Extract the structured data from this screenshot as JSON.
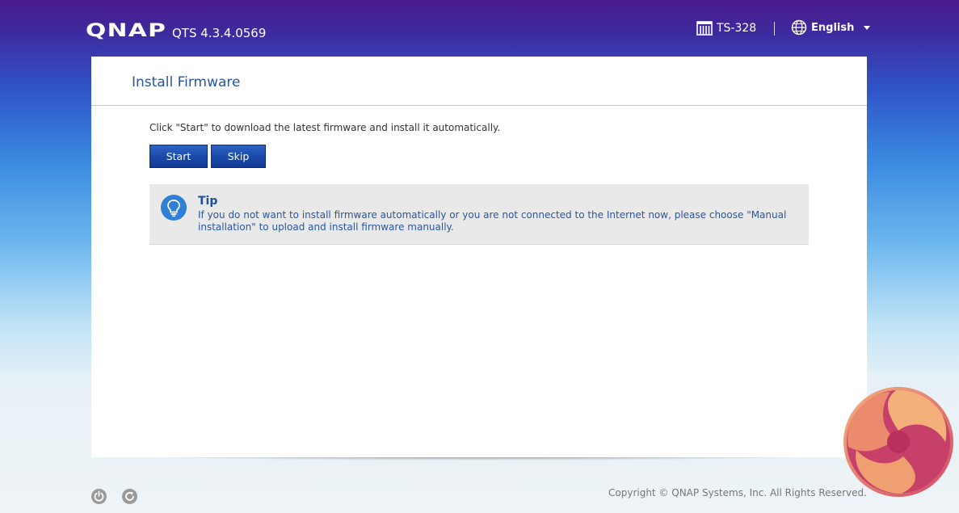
{
  "header": {
    "logo": "QNAP",
    "version": "QTS 4.3.4.0569",
    "model": "TS-328",
    "language": "English"
  },
  "panel": {
    "title": "Install Firmware",
    "description": "Click \"Start\" to download the latest firmware and install it automatically.",
    "buttons": {
      "start": "Start",
      "skip": "Skip"
    },
    "tip": {
      "title": "Tip",
      "text_before": "If you do not want to install firmware automatically or you are not connected to the Internet now, please choose ",
      "link": "\"Manual installation\"",
      "text_after": " to upload and install firmware manually."
    }
  },
  "footer": {
    "copyright": "Copyright © QNAP Systems, Inc. All Rights Reserved."
  },
  "icons": [
    "nas-icon",
    "globe-icon",
    "chevron-down-icon",
    "lightbulb-icon",
    "power-icon",
    "restart-icon"
  ],
  "colors": {
    "accent": "#2a56a0",
    "button": "#1a48a8",
    "header": "#4a1a8c"
  }
}
